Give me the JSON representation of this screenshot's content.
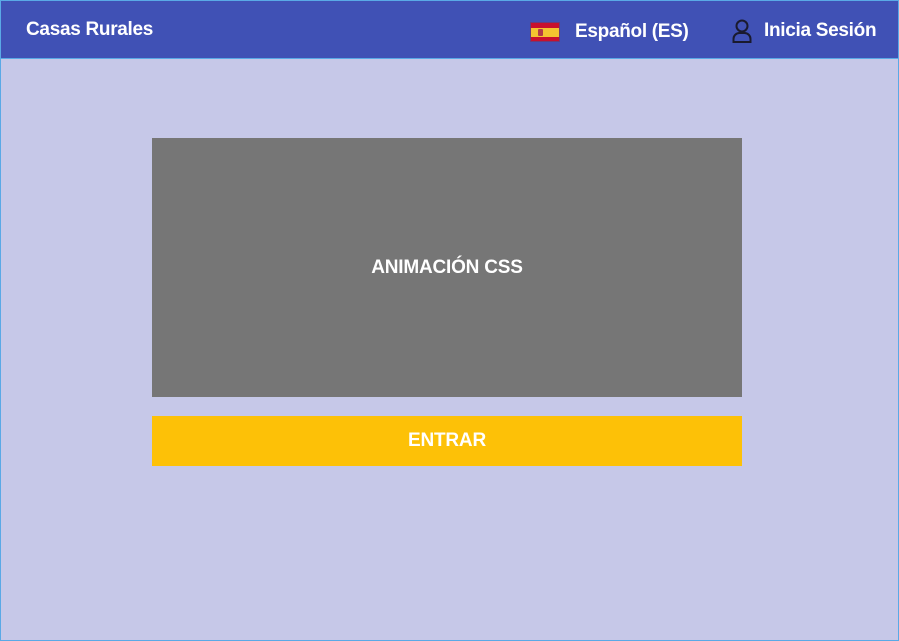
{
  "header": {
    "brand": "Casas Rurales",
    "language": {
      "label": "Español (ES)",
      "flag_icon": "spain-flag-icon"
    },
    "login": {
      "label": "Inicia Sesión",
      "icon": "user-icon"
    }
  },
  "main": {
    "animation_label": "ANIMACIÓN CSS",
    "enter_label": "ENTRAR"
  },
  "colors": {
    "header_bg": "#4051b5",
    "page_bg": "#c6c8e8",
    "animation_bg": "#767676",
    "button_bg": "#fdc107",
    "text_light": "#ffffff"
  }
}
